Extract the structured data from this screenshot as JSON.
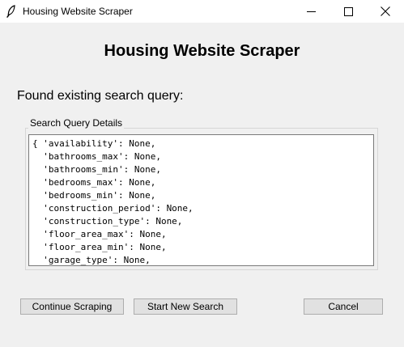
{
  "window": {
    "title": "Housing Website Scraper",
    "icon": "feather-icon",
    "controls": [
      "minimize-icon",
      "maximize-icon",
      "close-icon"
    ]
  },
  "main": {
    "heading": "Housing Website Scraper",
    "status": "Found existing search query:"
  },
  "query_group": {
    "label": "Search Query Details",
    "lines": [
      "{ 'availability': None,",
      "  'bathrooms_max': None,",
      "  'bathrooms_min': None,",
      "  'bedrooms_max': None,",
      "  'bedrooms_min': None,",
      "  'construction_period': None,",
      "  'construction_type': None,",
      "  'floor_area_max': None,",
      "  'floor_area_min': None,",
      "  'garage_type': None,"
    ]
  },
  "buttons": {
    "continue": "Continue Scraping",
    "new_search": "Start New Search",
    "cancel": "Cancel"
  }
}
